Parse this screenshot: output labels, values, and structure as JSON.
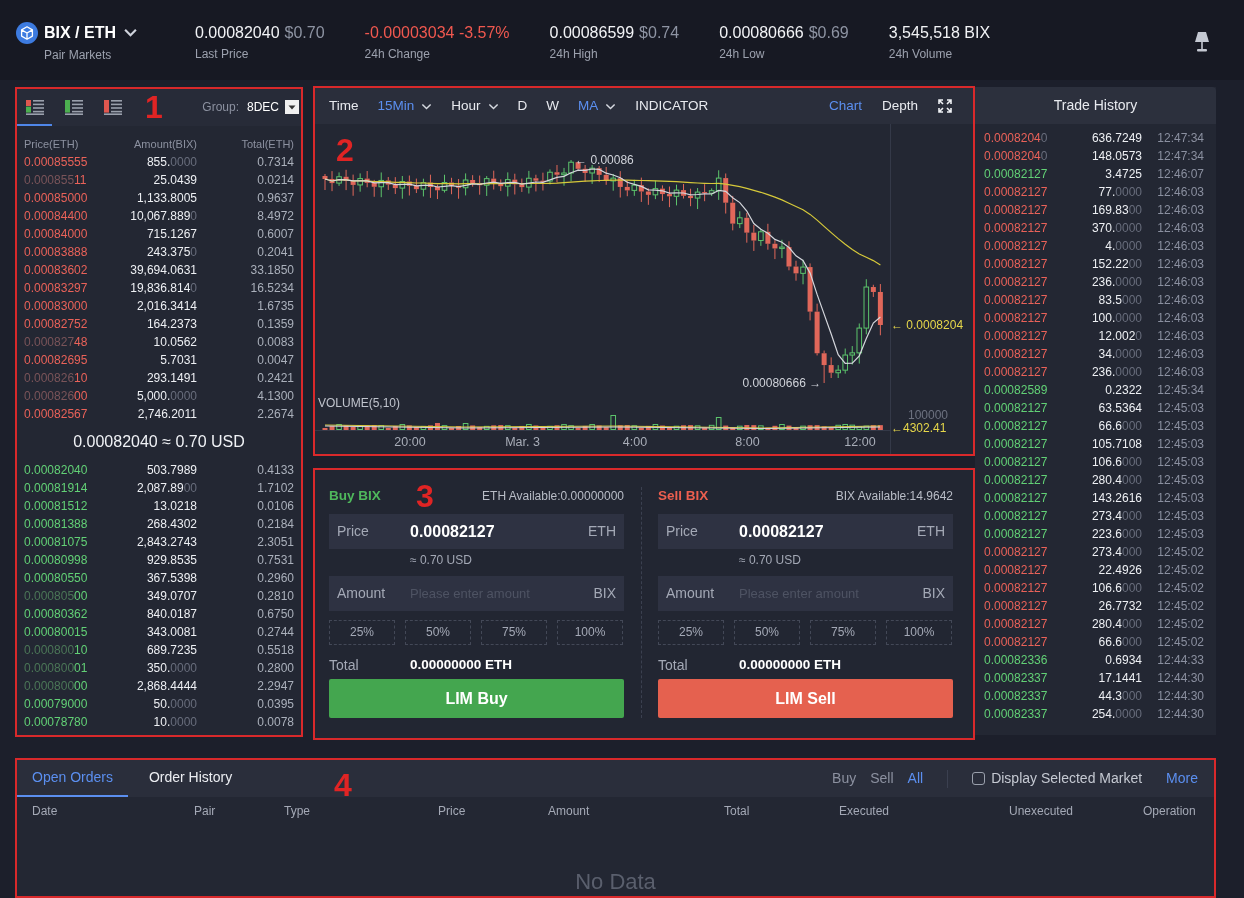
{
  "header": {
    "pair": "BIX / ETH",
    "pair_caption": "Pair Markets",
    "stats": [
      {
        "value": "0.00082040",
        "usd": "$0.70",
        "label": "Last Price",
        "color": "#f2f3f6"
      },
      {
        "value": "-0.00003034 -3.57%",
        "label": "24h Change",
        "color": "#f0584f"
      },
      {
        "value": "0.00086599",
        "usd": "$0.74",
        "label": "24h High",
        "color": "#f2f3f6"
      },
      {
        "value": "0.00080666",
        "usd": "$0.69",
        "label": "24h Low",
        "color": "#f2f3f6"
      },
      {
        "value": "3,545,518 BIX",
        "label": "24h Volume",
        "color": "#f2f3f6"
      }
    ]
  },
  "order_book": {
    "frame_label": "1",
    "views": [
      {
        "kind": "both",
        "selected": true
      },
      {
        "kind": "bids",
        "selected": false
      },
      {
        "kind": "asks",
        "selected": false
      }
    ],
    "group_label": "Group:",
    "group_value": "8DEC",
    "columns": [
      "Price(ETH)",
      "Amount(BIX)",
      "Total(ETH)"
    ],
    "asks": [
      {
        "price": "0.00085555",
        "amount": "855.",
        "amount_tail": "0000",
        "total": "0.7314"
      },
      {
        "price_head": "0.000855",
        "price": "11",
        "amount": "25.0439",
        "total": "0.0214"
      },
      {
        "price": "0.00085000",
        "amount": "1,133.8005",
        "total": "0.9637"
      },
      {
        "price": "0.00084400",
        "amount": "10,067.889",
        "amount_tail": "0",
        "total": "8.4972"
      },
      {
        "price": "0.00084000",
        "amount": "715.1267",
        "total": "0.6007"
      },
      {
        "price": "0.00083888",
        "amount": "243.375",
        "amount_tail": "0",
        "total": "0.2041"
      },
      {
        "price": "0.00083602",
        "amount": "39,694.0631",
        "total": "33.1850"
      },
      {
        "price": "0.00083297",
        "amount": "19,836.814",
        "amount_tail": "0",
        "total": "16.5234"
      },
      {
        "price": "0.00083000",
        "amount": "2,016.3414",
        "total": "1.6735"
      },
      {
        "price": "0.00082752",
        "amount": "164.2373",
        "total": "0.1359"
      },
      {
        "price_head": "0.000827",
        "price": "48",
        "amount": "10.0562",
        "total": "0.0083"
      },
      {
        "price": "0.00082695",
        "amount": "5.7031",
        "total": "0.0047"
      },
      {
        "price_head": "0.000826",
        "price": "10",
        "amount": "293.1491",
        "total": "0.2421"
      },
      {
        "price_head": "0.000826",
        "price": "00",
        "amount": "5,000.",
        "amount_tail": "0000",
        "total": "4.1300"
      },
      {
        "price": "0.00082567",
        "amount": "2,746.2011",
        "total": "2.2674"
      }
    ],
    "spread": "0.00082040 ≈ 0.70 USD",
    "bids": [
      {
        "price": "0.00082040",
        "amount": "503.7989",
        "total": "0.4133"
      },
      {
        "price": "0.00081914",
        "amount": "2,087.89",
        "amount_tail": "00",
        "total": "1.7102"
      },
      {
        "price": "0.00081512",
        "amount": "13.0218",
        "total": "0.0106"
      },
      {
        "price": "0.00081388",
        "amount": "268.4302",
        "total": "0.2184"
      },
      {
        "price": "0.00081075",
        "amount": "2,843.2743",
        "total": "2.3051"
      },
      {
        "price": "0.00080998",
        "amount": "929.8535",
        "total": "0.7531"
      },
      {
        "price": "0.00080550",
        "amount": "367.5398",
        "total": "0.2960"
      },
      {
        "price_head": "0.000805",
        "price": "00",
        "amount": "349.0707",
        "total": "0.2810"
      },
      {
        "price": "0.00080362",
        "amount": "840.0187",
        "total": "0.6750"
      },
      {
        "price": "0.00080015",
        "amount": "343.0081",
        "total": "0.2744"
      },
      {
        "price_head": "0.000800",
        "price": "10",
        "amount": "689.7235",
        "total": "0.5518"
      },
      {
        "price_head": "0.000800",
        "price": "01",
        "amount": "350.",
        "amount_tail": "0000",
        "total": "0.2800"
      },
      {
        "price_head": "0.000800",
        "price": "00",
        "amount": "2,868.4444",
        "total": "2.2947"
      },
      {
        "price": "0.00079000",
        "amount": "50.",
        "amount_tail": "0000",
        "total": "0.0395"
      },
      {
        "price": "0.00078780",
        "amount": "10.",
        "amount_tail": "0000",
        "total": "0.0078"
      }
    ]
  },
  "chart": {
    "frame_label": "2",
    "toolbar": [
      {
        "label": "Time",
        "dropdown": false,
        "selected": false
      },
      {
        "label": "15Min",
        "dropdown": true,
        "selected": true
      },
      {
        "label": "Hour",
        "dropdown": true,
        "selected": false
      },
      {
        "label": "D",
        "dropdown": false,
        "selected": false
      },
      {
        "label": "W",
        "dropdown": false,
        "selected": false
      },
      {
        "label": "MA",
        "dropdown": true,
        "selected": true
      },
      {
        "label": "INDICATOR",
        "dropdown": false,
        "selected": false
      }
    ],
    "views": [
      {
        "label": "Chart",
        "selected": true
      },
      {
        "label": "Depth",
        "selected": false
      }
    ],
    "volume_label": "VOLUME(5,10)",
    "x_labels": [
      "20:00",
      "Mar. 3",
      "4:00",
      "8:00",
      "12:00"
    ],
    "markers": [
      {
        "kind": "high",
        "text": "← 0.00086"
      },
      {
        "kind": "low",
        "text": "0.00080666 →"
      },
      {
        "kind": "last_price",
        "text": "← 0.0008204"
      },
      {
        "kind": "volume_scale",
        "text": "100000"
      },
      {
        "kind": "last_volume",
        "text": "←4302.41"
      }
    ]
  },
  "order_forms": {
    "frame_label": "3",
    "forms": [
      {
        "kind": "buy",
        "title": "Buy BIX",
        "available": "ETH Available:0.00000000",
        "price": {
          "label": "Price",
          "value": "0.00082127",
          "unit": "ETH",
          "hint": "≈ 0.70 USD"
        },
        "amount": {
          "label": "Amount",
          "placeholder": "Please enter amount",
          "unit": "BIX"
        },
        "percents": [
          "25%",
          "50%",
          "75%",
          "100%"
        ],
        "total_label": "Total",
        "total": "0.00000000 ETH",
        "submit": "LIM Buy"
      },
      {
        "kind": "sell",
        "title": "Sell BIX",
        "available": "BIX Available:14.9642",
        "price": {
          "label": "Price",
          "value": "0.00082127",
          "unit": "ETH",
          "hint": "≈ 0.70 USD"
        },
        "amount": {
          "label": "Amount",
          "placeholder": "Please enter amount",
          "unit": "BIX"
        },
        "percents": [
          "25%",
          "50%",
          "75%",
          "100%"
        ],
        "total_label": "Total",
        "total": "0.00000000 ETH",
        "submit": "LIM Sell"
      }
    ]
  },
  "trade_history": {
    "title": "Trade History",
    "trades": [
      {
        "color": "#ea6259",
        "price": "0.0008204",
        "price_tail": "0",
        "amount": "636.7249",
        "time": "12:47:34"
      },
      {
        "color": "#ea6259",
        "price": "0.0008204",
        "price_tail": "0",
        "amount": "148.0573",
        "time": "12:47:34"
      },
      {
        "color": "#62d176",
        "price": "0.00082127",
        "amount": "3.4725",
        "time": "12:46:07"
      },
      {
        "color": "#ea6259",
        "price": "0.00082127",
        "amount": "77.",
        "amount_tail": "0000",
        "time": "12:46:03"
      },
      {
        "color": "#ea6259",
        "price": "0.00082127",
        "amount": "169.83",
        "amount_tail": "00",
        "time": "12:46:03"
      },
      {
        "color": "#ea6259",
        "price": "0.00082127",
        "amount": "370.",
        "amount_tail": "0000",
        "time": "12:46:03"
      },
      {
        "color": "#ea6259",
        "price": "0.00082127",
        "amount": "4.",
        "amount_tail": "0000",
        "time": "12:46:03"
      },
      {
        "color": "#ea6259",
        "price": "0.00082127",
        "amount": "152.22",
        "amount_tail": "00",
        "time": "12:46:03"
      },
      {
        "color": "#ea6259",
        "price": "0.00082127",
        "amount": "236.",
        "amount_tail": "0000",
        "time": "12:46:03"
      },
      {
        "color": "#ea6259",
        "price": "0.00082127",
        "amount": "83.5",
        "amount_tail": "000",
        "time": "12:46:03"
      },
      {
        "color": "#ea6259",
        "price": "0.00082127",
        "amount": "100.",
        "amount_tail": "0000",
        "time": "12:46:03"
      },
      {
        "color": "#ea6259",
        "price": "0.00082127",
        "amount": "12.002",
        "amount_tail": "0",
        "time": "12:46:03"
      },
      {
        "color": "#ea6259",
        "price": "0.00082127",
        "amount": "34.",
        "amount_tail": "0000",
        "time": "12:46:03"
      },
      {
        "color": "#ea6259",
        "price": "0.00082127",
        "amount": "236.",
        "amount_tail": "0000",
        "time": "12:46:03"
      },
      {
        "color": "#62d176",
        "price": "0.00082589",
        "amount": "0.2322",
        "time": "12:45:34"
      },
      {
        "color": "#62d176",
        "price": "0.00082127",
        "amount": "63.5364",
        "time": "12:45:03"
      },
      {
        "color": "#62d176",
        "price": "0.00082127",
        "amount": "66.6",
        "amount_tail": "000",
        "time": "12:45:03"
      },
      {
        "color": "#62d176",
        "price": "0.00082127",
        "amount": "105.7108",
        "time": "12:45:03"
      },
      {
        "color": "#62d176",
        "price": "0.00082127",
        "amount": "106.6",
        "amount_tail": "000",
        "time": "12:45:03"
      },
      {
        "color": "#62d176",
        "price": "0.00082127",
        "amount": "280.4",
        "amount_tail": "000",
        "time": "12:45:03"
      },
      {
        "color": "#62d176",
        "price": "0.00082127",
        "amount": "143.2616",
        "time": "12:45:03"
      },
      {
        "color": "#62d176",
        "price": "0.00082127",
        "amount": "273.4",
        "amount_tail": "000",
        "time": "12:45:03"
      },
      {
        "color": "#62d176",
        "price": "0.00082127",
        "amount": "223.6",
        "amount_tail": "000",
        "time": "12:45:03"
      },
      {
        "color": "#ea6259",
        "price": "0.00082127",
        "amount": "273.4",
        "amount_tail": "000",
        "time": "12:45:02"
      },
      {
        "color": "#ea6259",
        "price": "0.00082127",
        "amount": "22.4926",
        "time": "12:45:02"
      },
      {
        "color": "#ea6259",
        "price": "0.00082127",
        "amount": "106.6",
        "amount_tail": "000",
        "time": "12:45:02"
      },
      {
        "color": "#ea6259",
        "price": "0.00082127",
        "amount": "26.7732",
        "time": "12:45:02"
      },
      {
        "color": "#ea6259",
        "price": "0.00082127",
        "amount": "280.4",
        "amount_tail": "000",
        "time": "12:45:02"
      },
      {
        "color": "#ea6259",
        "price": "0.00082127",
        "amount": "66.6",
        "amount_tail": "000",
        "time": "12:45:02"
      },
      {
        "color": "#62d176",
        "price": "0.00082336",
        "amount": "0.6934",
        "time": "12:44:33"
      },
      {
        "color": "#62d176",
        "price": "0.00082337",
        "amount": "17.1441",
        "time": "12:44:30"
      },
      {
        "color": "#62d176",
        "price": "0.00082337",
        "amount": "44.3",
        "amount_tail": "000",
        "time": "12:44:30"
      },
      {
        "color": "#62d176",
        "price": "0.00082337",
        "amount": "254.",
        "amount_tail": "0000",
        "time": "12:44:30"
      }
    ]
  },
  "orders": {
    "frame_label": "4",
    "tabs": [
      {
        "label": "Open Orders",
        "selected": true
      },
      {
        "label": "Order History",
        "selected": false
      }
    ],
    "filters": [
      {
        "label": "Buy",
        "selected": false
      },
      {
        "label": "Sell",
        "selected": false
      },
      {
        "label": "All",
        "selected": true
      }
    ],
    "market_filter": {
      "label": "Display Selected Market",
      "checked": false
    },
    "more": "More",
    "columns": [
      "Date",
      "Pair",
      "Type",
      "Price",
      "Amount",
      "Total",
      "Executed",
      "Unexecuted",
      "Operation"
    ],
    "empty_text": "No Data"
  }
}
